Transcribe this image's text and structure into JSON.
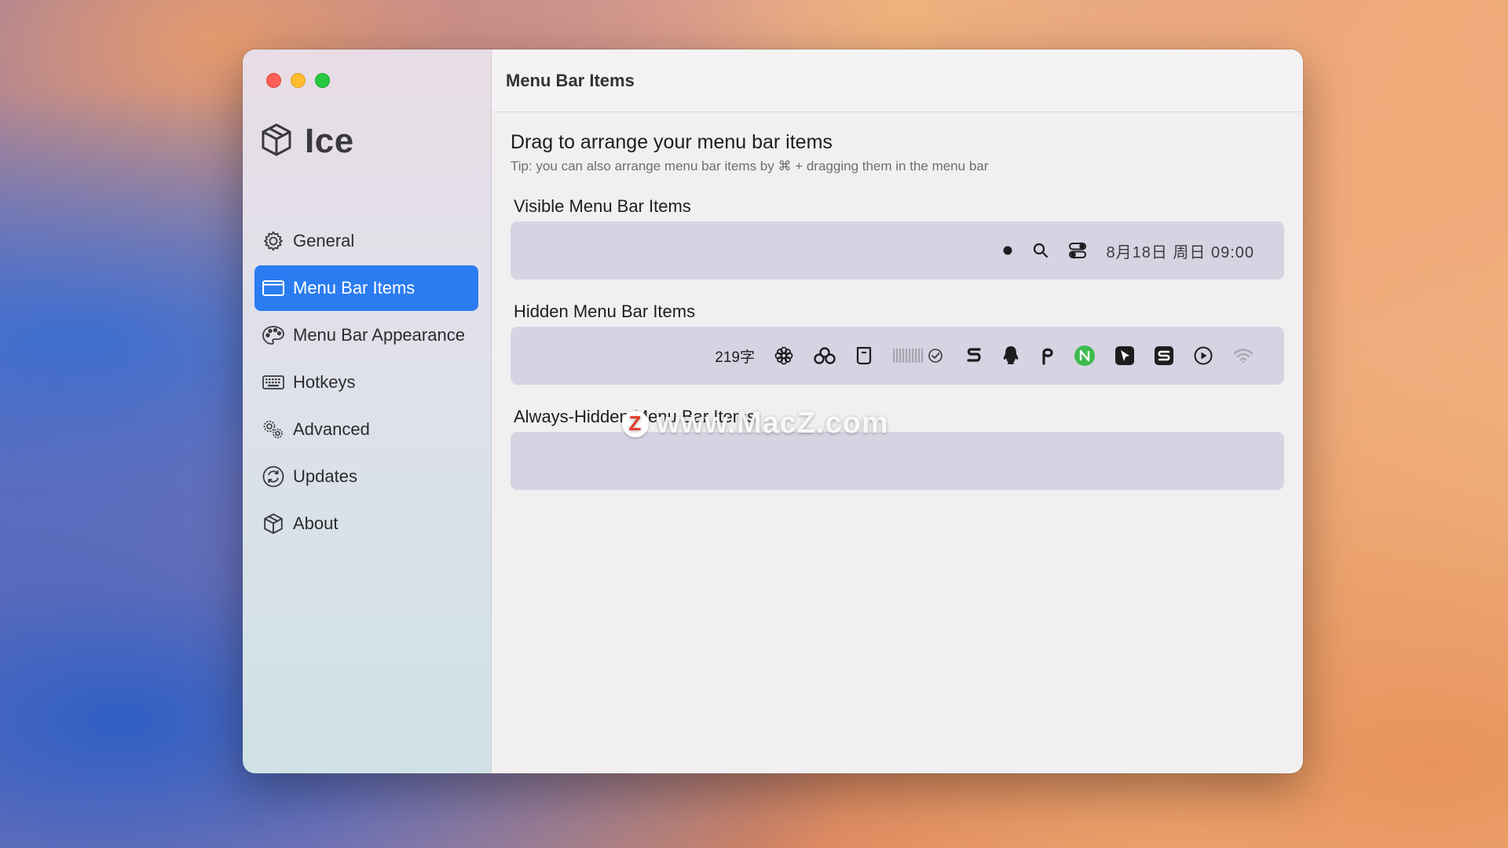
{
  "app": {
    "name": "Ice"
  },
  "sidebar": {
    "items": [
      {
        "label": "General",
        "icon": "gear-icon"
      },
      {
        "label": "Menu Bar Items",
        "icon": "window-icon",
        "active": true
      },
      {
        "label": "Menu Bar Appearance",
        "icon": "palette-icon"
      },
      {
        "label": "Hotkeys",
        "icon": "keyboard-icon"
      },
      {
        "label": "Advanced",
        "icon": "gears-icon"
      },
      {
        "label": "Updates",
        "icon": "refresh-icon"
      },
      {
        "label": "About",
        "icon": "cube-icon"
      }
    ]
  },
  "toolbar": {
    "title": "Menu Bar Items"
  },
  "main": {
    "heading": "Drag to arrange your menu bar items",
    "tip": "Tip: you can also arrange menu bar items by ⌘ + dragging them in the menu bar",
    "visible": {
      "label": "Visible Menu Bar Items",
      "clock": "8月18日 周日  09:00",
      "icons": [
        "dot-icon",
        "search-icon",
        "control-center-icon"
      ]
    },
    "hidden": {
      "label": "Hidden Menu Bar Items",
      "word_count": "219字",
      "icons": [
        "flower-icon",
        "cloud-cluster-icon",
        "cup-icon",
        "progress-check-icon",
        "s-logo-icon",
        "qq-icon",
        "p-logo-icon",
        "n-logo-icon",
        "cursor-logo-icon",
        "s-box-icon",
        "play-circle-icon",
        "wifi-icon"
      ]
    },
    "always_hidden": {
      "label": "Always-Hidden Menu Bar Items"
    }
  },
  "watermark": {
    "text": "www.MacZ.com",
    "badge": "Z"
  }
}
